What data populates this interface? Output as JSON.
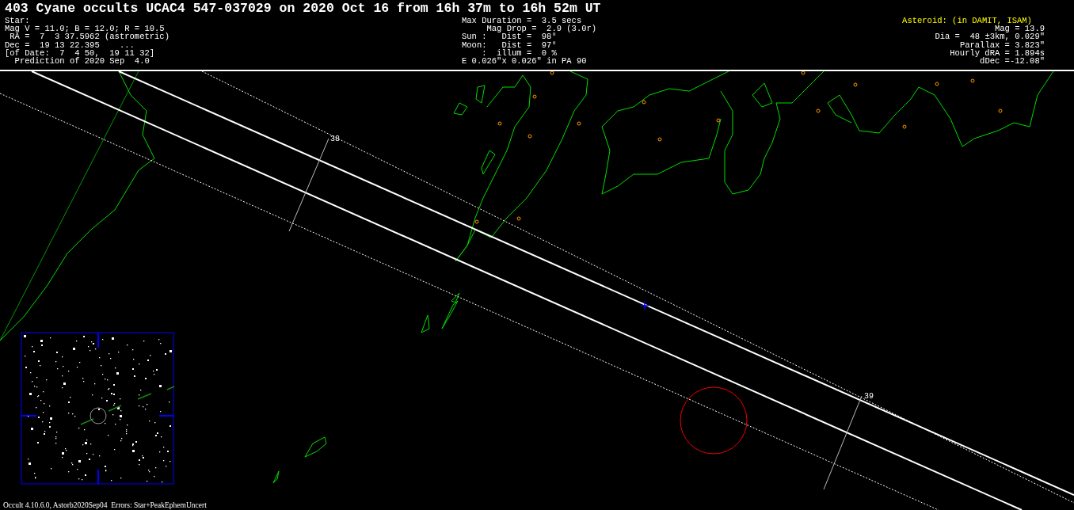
{
  "title": "403 Cyane occults UCAC4 547-037029 on 2020 Oct 16 from 16h 37m to 16h 52m UT",
  "star_info": [
    "Star:",
    "Mag V = 11.0; B = 12.0; R = 10.5",
    " RA =  7  3 37.5962 (astrometric)",
    "Dec =  19 13 22.395    ...",
    "[of Date:  7  4 50,  19 11 32]",
    "  Prediction of 2020 Sep  4.0"
  ],
  "event_info": [
    "Max Duration =  3.5 secs",
    "     Mag Drop =  2.9 (3.0r)",
    "Sun :   Dist =  98°",
    "Moon:   Dist =  97°",
    "    :  illum =  0 %",
    "E 0.026\"x 0.026\" in PA 90"
  ],
  "asteroid_info": {
    "heading": "Asteroid: (in DAMIT, ISAM)",
    "lines": [
      "Mag = 13.9",
      "Dia =  48 ±3km, 0.029\"",
      "Parallax = 3.823\"",
      "Hourly dRA = 1.894s",
      "dDec =-12.08\""
    ]
  },
  "map": {
    "time_marks": [
      "38",
      "39"
    ]
  },
  "footer": "Occult 4.10.6.0, Astorb2020Sep04  Errors: Star+PeakEphemUncert"
}
